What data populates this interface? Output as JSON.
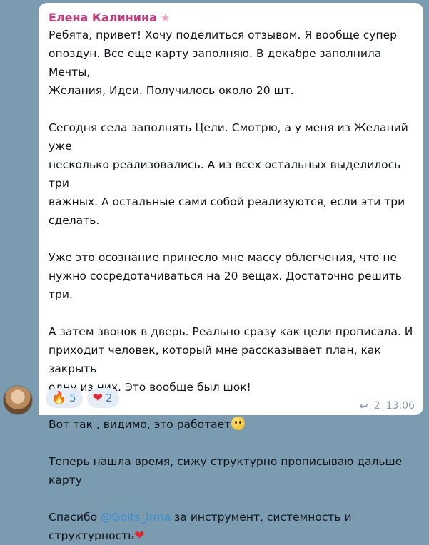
{
  "author": "Елена Калинина",
  "author_badge_icon": "star-icon",
  "paragraphs": [
    [
      "Ребята, привет! Хочу поделиться отзывом. Я вообще супер",
      "опоздун. Все еще карту заполняю. В декабре заполнила Мечты,",
      "Желания, Идеи. Получилось около 20 шт."
    ],
    [
      "Сегодня села заполнять Цели. Смотрю, а у меня из Желаний уже",
      "несколько реализовались. А из всех остальных выделилось три",
      "важных. А остальные сами собой реализуются, если эти три",
      "сделать."
    ],
    [
      "Уже это осознание принесло мне массу облегчения, что не",
      "нужно сосредотачиваться на 20 вещах. Достаточно решить три."
    ],
    [
      "А затем звонок в дверь. Реально сразу как цели прописала. И",
      "приходит человек, который мне рассказывает план, как закрыть",
      "одну из них. Это вообще был шок!"
    ],
    [
      "Вот так , видимо, это работает"
    ],
    [
      "Теперь нашла время, сижу структурно прописываю дальше",
      "карту"
    ]
  ],
  "closing": {
    "before": "Спасибо ",
    "mention": "@Golts_irma",
    "after": " за инструмент, системность и",
    "line2": "структурность"
  },
  "reactions": [
    {
      "emoji": "🔥",
      "icon": "fire-icon",
      "count": "5"
    },
    {
      "emoji": "❤",
      "icon": "heart-icon",
      "count": "2"
    }
  ],
  "replies_count": "2",
  "time": "13:06"
}
